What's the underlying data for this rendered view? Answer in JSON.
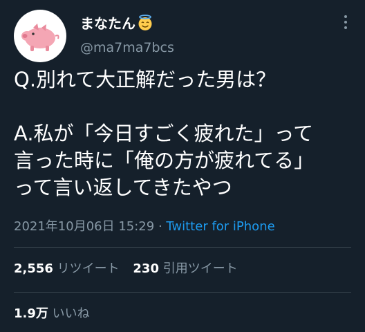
{
  "author": {
    "display_name": "まなたん",
    "emoji_icon": "smiling-face-with-halo-icon",
    "handle": "@ma7ma7bcs",
    "avatar_icon": "pig-icon"
  },
  "tweet": {
    "lines": [
      "Q.別れて大正解だった男は？",
      "",
      "A.私が「今日すごく疲れた」って",
      "言った時に「俺の方が疲れてる」",
      "って言い返してきたやつ"
    ]
  },
  "meta": {
    "timestamp": "2021年10月06日 15:29",
    "separator": " · ",
    "source": "Twitter for iPhone"
  },
  "stats": {
    "retweets_count": "2,556",
    "retweets_label": "リツイート",
    "quotes_count": "230",
    "quotes_label": "引用ツイート",
    "likes_count": "1.9万",
    "likes_label": "いいね"
  },
  "colors": {
    "background": "#15202b",
    "text": "#ffffff",
    "secondary": "#8899a6",
    "link": "#1d9bf0",
    "divider": "#38444d"
  }
}
